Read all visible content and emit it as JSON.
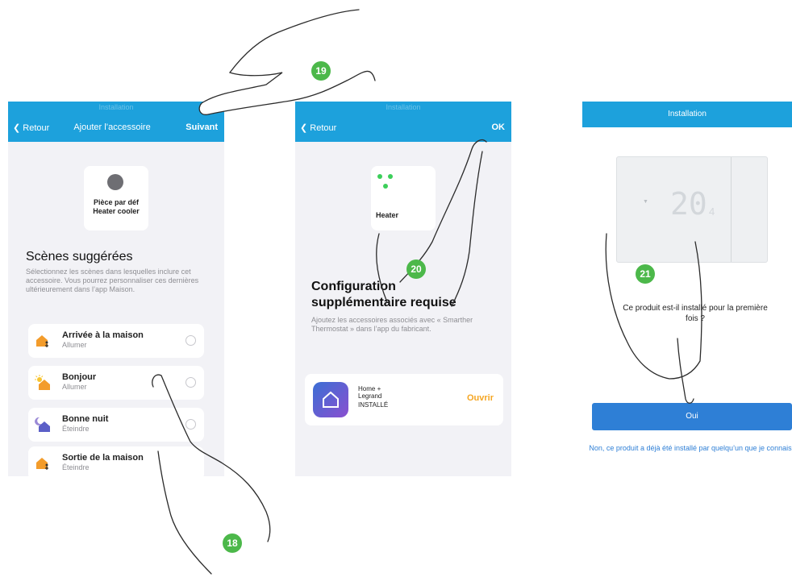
{
  "screen1": {
    "nav_faint": "Installation",
    "back": "Retour",
    "title": "Ajouter l’accessoire",
    "next": "Suivant",
    "accessory_room": "Pièce par déf",
    "accessory_name": "Heater cooler",
    "section_title": "Scènes suggérées",
    "section_desc": "Sélectionnez les scènes dans lesquelles inclure cet accessoire. Vous pourrez personnaliser ces dernières ultérieurement dans l’app Maison.",
    "scenes": [
      {
        "name": "Arrivée à la maison",
        "action": "Allumer",
        "icon": "home-arrive-icon"
      },
      {
        "name": "Bonjour",
        "action": "Allumer",
        "icon": "sun-home-icon"
      },
      {
        "name": "Bonne nuit",
        "action": "Éteindre",
        "icon": "moon-home-icon"
      },
      {
        "name": "Sortie de la maison",
        "action": "Éteindre",
        "icon": "home-leave-icon"
      }
    ]
  },
  "screen2": {
    "nav_faint": "Installation",
    "back": "Retour",
    "ok": "OK",
    "accessory_name": "Heater",
    "heading": "Configuration supplémentaire requise",
    "desc": "Ajoutez les accessoires associés avec « Smarther Thermostat » dans l’app du fabricant.",
    "app_name": "Home + Legrand",
    "app_status": "INSTALLÉ",
    "open": "Ouvrir"
  },
  "screen3": {
    "title": "Installation",
    "display_value": "20",
    "display_sub": "4",
    "question": "Ce produit est-il installé pour la première fois ?",
    "yes": "Oui",
    "no": "Non, ce produit a déjà été installé par quelqu’un que je connais"
  },
  "steps": [
    "18",
    "19",
    "20",
    "21"
  ],
  "colors": {
    "nav": "#1da1dc",
    "primary_button": "#2e7fd6",
    "badge": "#4cb84a",
    "link": "#2e7fd6",
    "open_link": "#f5a623"
  }
}
